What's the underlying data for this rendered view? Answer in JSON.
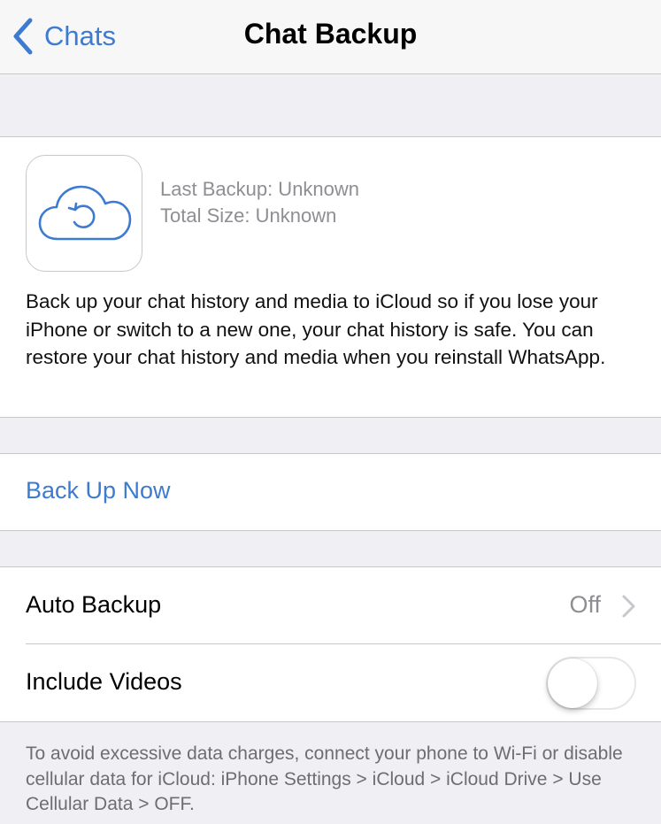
{
  "nav": {
    "back_label": "Chats",
    "title": "Chat Backup",
    "back_icon": "chevron-left-icon"
  },
  "backup_info": {
    "icon": "icloud-restore-icon",
    "last_backup": "Last Backup: Unknown",
    "total_size": "Total Size: Unknown",
    "description": "Back up your chat history and media to iCloud so if you lose your iPhone or switch to a new one, your chat history is safe. You can restore your chat history and media when you reinstall WhatsApp."
  },
  "actions": {
    "backup_now_label": "Back Up Now"
  },
  "settings": {
    "auto_backup": {
      "label": "Auto Backup",
      "value": "Off"
    },
    "include_videos": {
      "label": "Include Videos",
      "enabled": false
    }
  },
  "footer": {
    "note": "To avoid excessive data charges, connect your phone to Wi-Fi or disable cellular data for iCloud: iPhone Settings > iCloud > iCloud Drive > Use Cellular Data > OFF."
  },
  "colors": {
    "accent": "#3d7bd1",
    "background": "#efeff4",
    "secondary_text": "#8e8e93",
    "separator": "#c8c7cc"
  }
}
